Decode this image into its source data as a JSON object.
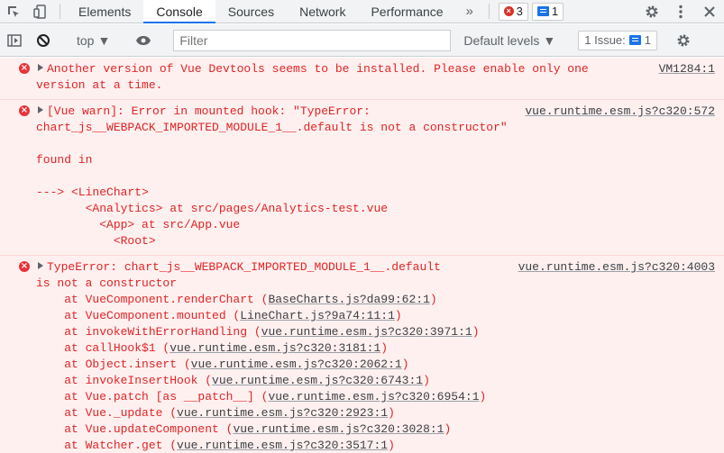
{
  "tabs": {
    "items": [
      "Elements",
      "Console",
      "Sources",
      "Network",
      "Performance"
    ],
    "more": "»",
    "error_count": "3",
    "message_count": "1"
  },
  "toolbar": {
    "context": "top",
    "filter_placeholder": "Filter",
    "levels": "Default levels",
    "issues_label": "1 Issue:",
    "issues_count": "1"
  },
  "log": {
    "entry1": {
      "source": "VM1284:1",
      "line1": "Another version of Vue Devtools seems to be installed. Please enable only one",
      "line2": "version at a time."
    },
    "entry2": {
      "source": "vue.runtime.esm.js?c320:572",
      "line1": "[Vue warn]: Error in mounted hook: \"TypeError:",
      "line2": "chart_js__WEBPACK_IMPORTED_MODULE_1__.default is not a constructor\"",
      "line3": "found in",
      "line4": "---> <LineChart>",
      "line5": "       <Analytics> at src/pages/Analytics-test.vue",
      "line6": "         <App> at src/App.vue",
      "line7": "           <Root>"
    },
    "entry3": {
      "source": "vue.runtime.esm.js?c320:4003",
      "line1": "TypeError: chart_js__WEBPACK_IMPORTED_MODULE_1__.default",
      "line2": "is not a constructor",
      "frames": [
        {
          "text": "    at VueComponent.renderChart (",
          "link": "BaseCharts.js?da99:62:1",
          "end": ")"
        },
        {
          "text": "    at VueComponent.mounted (",
          "link": "LineChart.js?9a74:11:1",
          "end": ")"
        },
        {
          "text": "    at invokeWithErrorHandling (",
          "link": "vue.runtime.esm.js?c320:3971:1",
          "end": ")"
        },
        {
          "text": "    at callHook$1 (",
          "link": "vue.runtime.esm.js?c320:3181:1",
          "end": ")"
        },
        {
          "text": "    at Object.insert (",
          "link": "vue.runtime.esm.js?c320:2062:1",
          "end": ")"
        },
        {
          "text": "    at invokeInsertHook (",
          "link": "vue.runtime.esm.js?c320:6743:1",
          "end": ")"
        },
        {
          "text": "    at Vue.patch [as __patch__] (",
          "link": "vue.runtime.esm.js?c320:6954:1",
          "end": ")"
        },
        {
          "text": "    at Vue._update (",
          "link": "vue.runtime.esm.js?c320:2923:1",
          "end": ")"
        },
        {
          "text": "    at Vue.updateComponent (",
          "link": "vue.runtime.esm.js?c320:3028:1",
          "end": ")"
        },
        {
          "text": "    at Watcher.get (",
          "link": "vue.runtime.esm.js?c320:3517:1",
          "end": ")"
        }
      ]
    }
  },
  "colors": {
    "error_text": "#e02424",
    "error_bg": "#fff0f0",
    "accent": "#1a73e8"
  }
}
